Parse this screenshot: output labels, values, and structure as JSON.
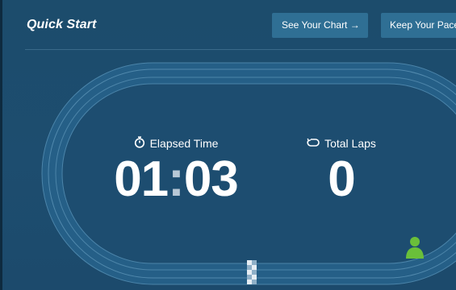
{
  "header": {
    "title": "Quick Start",
    "see_chart_label": "See Your Chart →",
    "keep_pace_label": "Keep Your Pace →"
  },
  "stats": {
    "elapsed": {
      "label": "Elapsed Time",
      "minutes": "01",
      "separator": ":",
      "seconds": "03",
      "icon": "stopwatch-icon"
    },
    "laps": {
      "label": "Total Laps",
      "value": "0",
      "icon": "loop-icon"
    }
  },
  "runner": {
    "icon": "runner-person-icon",
    "color": "#6abf3a"
  },
  "colors": {
    "background": "#1d4d6f",
    "track": "#2a6892",
    "button": "#2f6f94",
    "text": "#ffffff"
  }
}
